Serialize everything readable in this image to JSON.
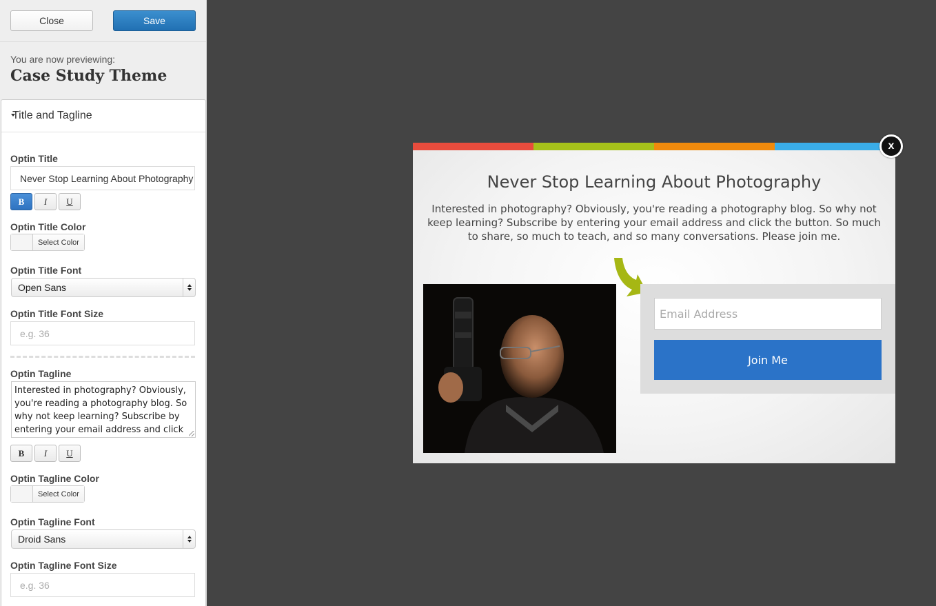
{
  "toolbar": {
    "close_label": "Close",
    "save_label": "Save"
  },
  "header": {
    "previewing_label": "You are now previewing:",
    "theme_name": "Case Study Theme"
  },
  "panel": {
    "section_title": "Title and Tagline",
    "optin_title_label": "Optin Title",
    "optin_title_value": "Never Stop Learning About Photography",
    "format_bold": "B",
    "format_italic": "I",
    "format_underline": "U",
    "title_color_label": "Optin Title Color",
    "select_color_label": "Select Color",
    "title_font_label": "Optin Title Font",
    "title_font_value": "Open Sans",
    "title_font_size_label": "Optin Title Font Size",
    "font_size_placeholder": "e.g. 36",
    "tagline_label": "Optin Tagline",
    "tagline_value": "Interested in photography?  Obviously, you're reading a photography blog.  So why not keep learning?  Subscribe by entering your email address and click the button.",
    "tagline_color_label": "Optin Tagline Color",
    "tagline_font_label": "Optin Tagline Font",
    "tagline_font_value": "Droid Sans",
    "tagline_font_size_label": "Optin Tagline Font Size"
  },
  "optin": {
    "title": "Never Stop Learning About Photography",
    "tagline": "Interested in photography? Obviously, you're reading a photography blog. So why not keep learning? Subscribe by entering your email address and click the button. So much to share, so much to teach, and so many conversations. Please join me.",
    "email_placeholder": "Email Address",
    "button_label": "Join Me",
    "close_label": "x",
    "stripe_colors": [
      "#e84c3d",
      "#a6c11a",
      "#f08a0c",
      "#3aade8"
    ],
    "button_color": "#2b73c8",
    "arrow_color": "#a6b714"
  }
}
